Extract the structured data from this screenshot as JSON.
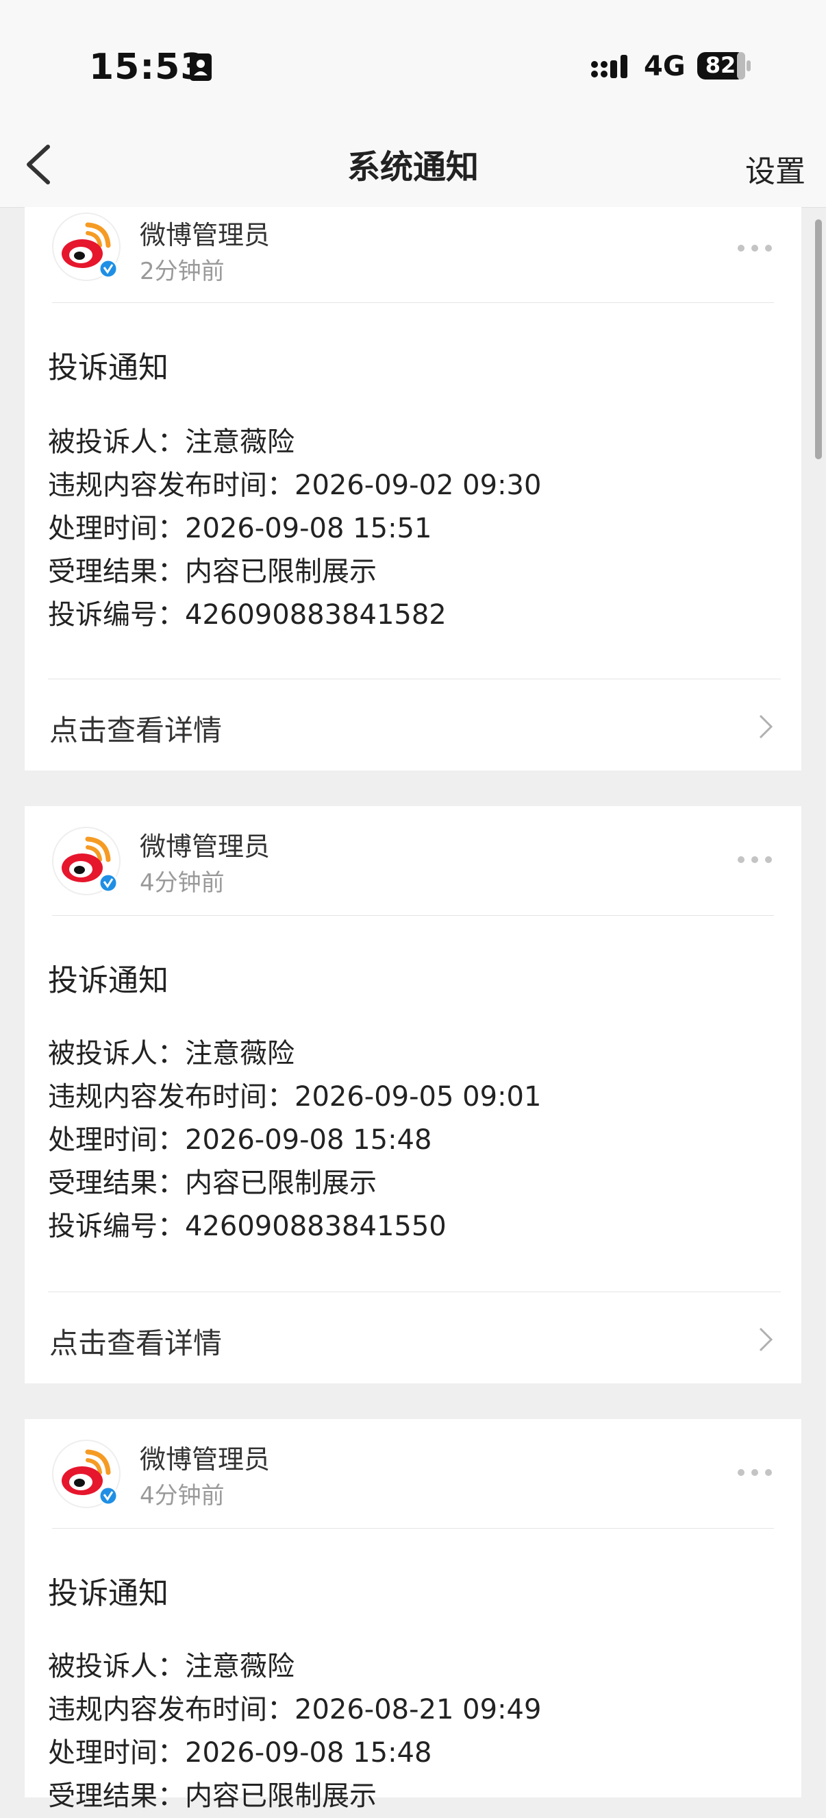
{
  "status_bar": {
    "time": "15:53",
    "network": "4G",
    "battery": "82"
  },
  "nav": {
    "title": "系统通知",
    "settings_label": "设置"
  },
  "colors": {
    "accent_blue": "#1f8fe5",
    "weibo_red": "#e6162d",
    "weibo_orange": "#f59b24"
  },
  "notifications": [
    {
      "sender": "微博管理员",
      "time": "2分钟前",
      "title": "投诉通知",
      "lines": [
        "被投诉人：注意薇险",
        "违规内容发布时间：2026-09-02 09:30",
        "处理时间：2026-09-08 15:51",
        "受理结果：内容已限制展示",
        "投诉编号：426090883841582"
      ],
      "detail_label": "点击查看详情"
    },
    {
      "sender": "微博管理员",
      "time": "4分钟前",
      "title": "投诉通知",
      "lines": [
        "被投诉人：注意薇险",
        "违规内容发布时间：2026-09-05 09:01",
        "处理时间：2026-09-08 15:48",
        "受理结果：内容已限制展示",
        "投诉编号：426090883841550"
      ],
      "detail_label": "点击查看详情"
    },
    {
      "sender": "微博管理员",
      "time": "4分钟前",
      "title": "投诉通知",
      "lines": [
        "被投诉人：注意薇险",
        "违规内容发布时间：2026-08-21 09:49",
        "处理时间：2026-09-08 15:48",
        "受理结果：内容已限制展示"
      ]
    }
  ]
}
